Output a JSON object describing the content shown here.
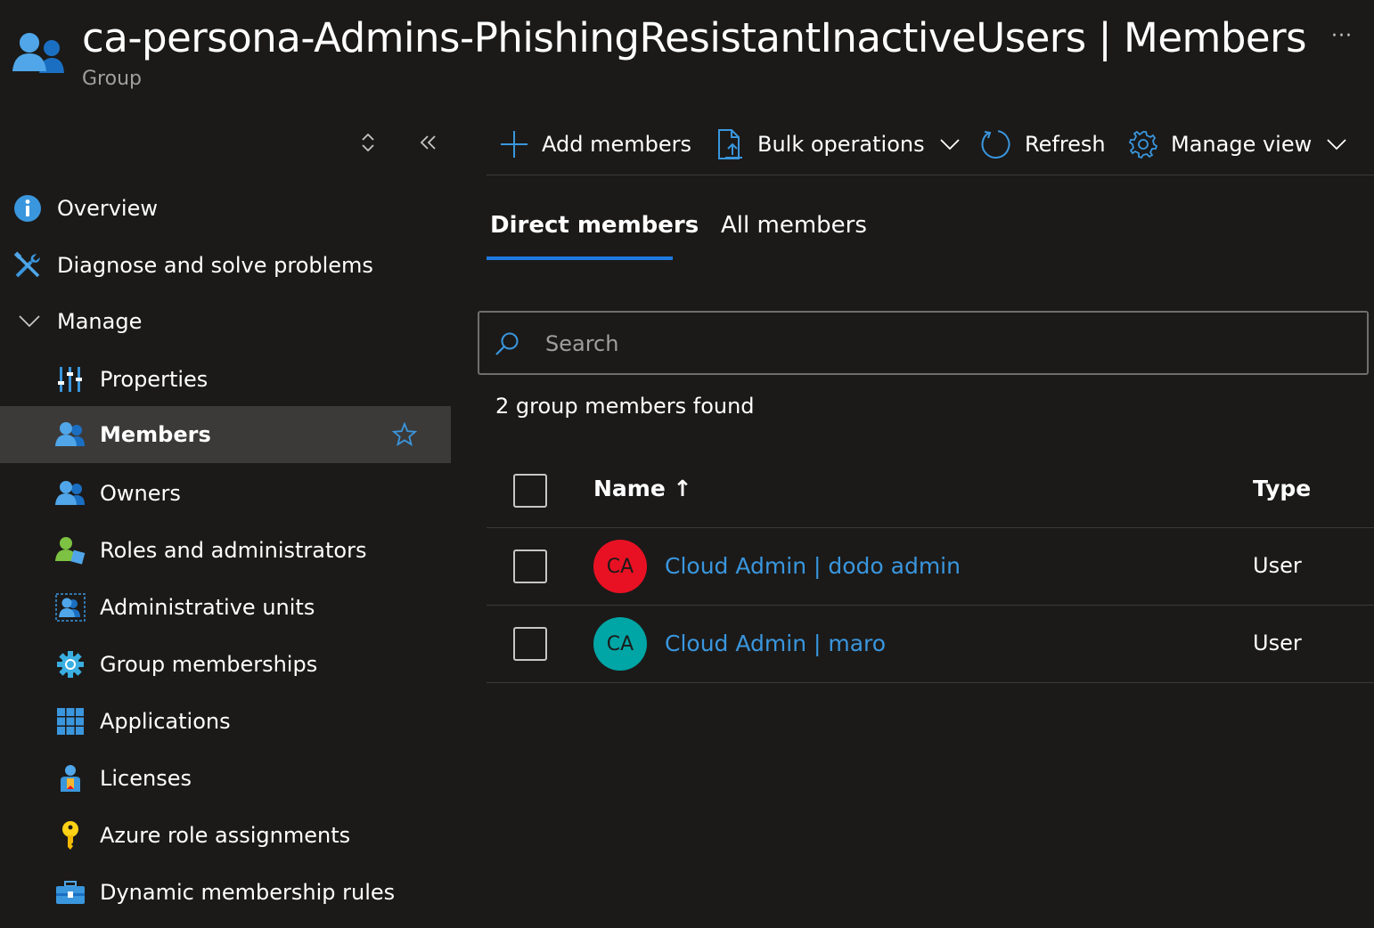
{
  "header": {
    "title": "ca-persona-Admins-PhishingResistantInactiveUsers | Members",
    "subtitle": "Group",
    "more_label": "···",
    "icon": "group-icon"
  },
  "sidebar": {
    "items": [
      {
        "label": "Overview",
        "icon": "info-icon"
      },
      {
        "label": "Diagnose and solve problems",
        "icon": "wrench-icon"
      },
      {
        "label": "Manage",
        "icon": "chevron-down-icon"
      },
      {
        "label": "Properties",
        "icon": "properties-icon"
      },
      {
        "label": "Members",
        "icon": "members-icon",
        "active": true
      },
      {
        "label": "Owners",
        "icon": "owners-icon"
      },
      {
        "label": "Roles and administrators",
        "icon": "roles-icon"
      },
      {
        "label": "Administrative units",
        "icon": "admin-units-icon"
      },
      {
        "label": "Group memberships",
        "icon": "gear-icon"
      },
      {
        "label": "Applications",
        "icon": "grid-icon"
      },
      {
        "label": "Licenses",
        "icon": "license-icon"
      },
      {
        "label": "Azure role assignments",
        "icon": "key-icon"
      },
      {
        "label": "Dynamic membership rules",
        "icon": "toolbox-icon"
      }
    ]
  },
  "toolbar": {
    "add_members": "Add members",
    "bulk_operations": "Bulk operations",
    "refresh": "Refresh",
    "manage_view": "Manage view"
  },
  "tabs": {
    "direct": "Direct members",
    "all": "All members"
  },
  "search": {
    "placeholder": "Search",
    "value": ""
  },
  "result_count": "2 group members found",
  "table": {
    "columns": {
      "name": "Name ↑",
      "type": "Type"
    },
    "rows": [
      {
        "initials": "CA",
        "name": "Cloud Admin | dodo admin",
        "type": "User",
        "avatar_color": "#e81123"
      },
      {
        "initials": "CA",
        "name": "Cloud Admin | maro",
        "type": "User",
        "avatar_color": "#00a5a5"
      }
    ]
  },
  "colors": {
    "accent": "#1f7ae0",
    "link": "#3a96dd",
    "background": "#1b1a19",
    "active_nav": "#3b3a39"
  }
}
